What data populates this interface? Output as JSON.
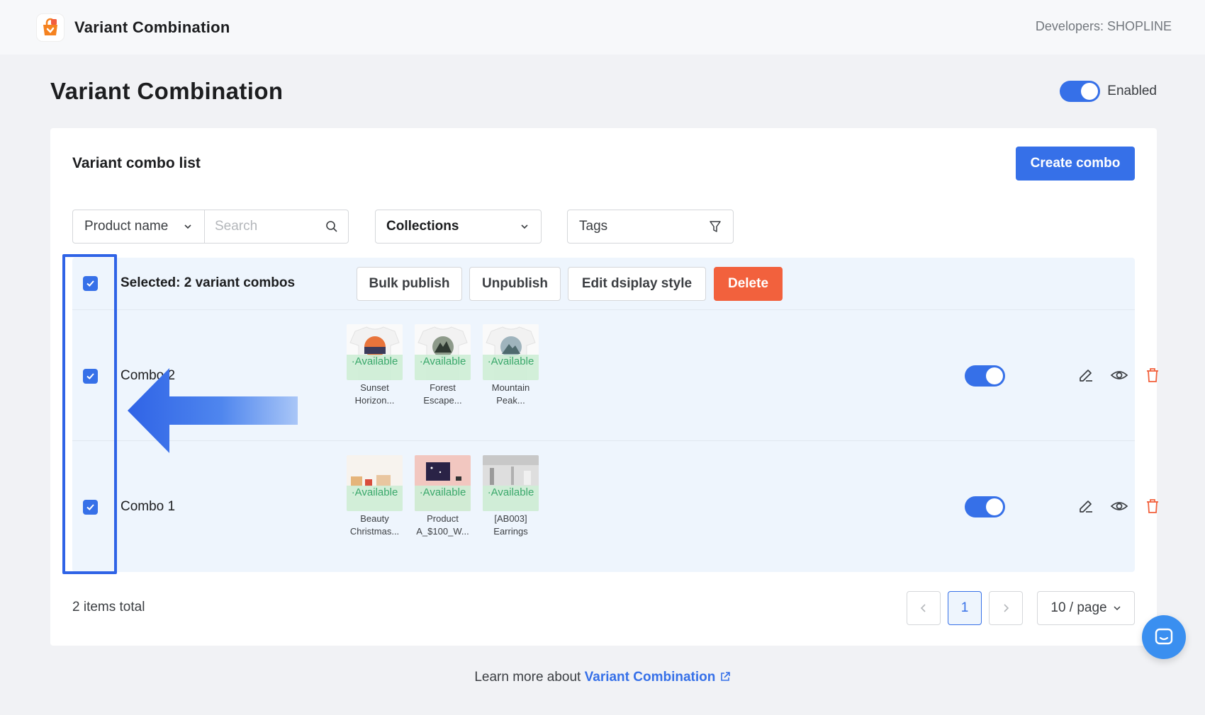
{
  "app": {
    "name": "Variant Combination",
    "developer": "Developers: SHOPLINE"
  },
  "page": {
    "title": "Variant Combination",
    "enabled_label": "Enabled",
    "enabled": true
  },
  "list": {
    "title": "Variant combo list",
    "create_button": "Create combo"
  },
  "filters": {
    "product_select": "Product name",
    "search_placeholder": "Search",
    "collections": "Collections",
    "tags": "Tags"
  },
  "bulk": {
    "selected_text": "Selected: 2 variant combos",
    "publish": "Bulk publish",
    "unpublish": "Unpublish",
    "edit_style": "Edit dsiplay style",
    "delete": "Delete"
  },
  "rows": [
    {
      "name": "Combo 2",
      "checked": true,
      "published": true,
      "products": [
        {
          "status": "·Available",
          "name_line1": "Sunset",
          "name_line2": "Horizon..."
        },
        {
          "status": "·Available",
          "name_line1": "Forest",
          "name_line2": "Escape..."
        },
        {
          "status": "·Available",
          "name_line1": "Mountain",
          "name_line2": "Peak..."
        }
      ]
    },
    {
      "name": "Combo 1",
      "checked": true,
      "published": true,
      "products": [
        {
          "status": "·Available",
          "name_line1": "Beauty",
          "name_line2": "Christmas..."
        },
        {
          "status": "·Available",
          "name_line1": "Product",
          "name_line2": "A_$100_W..."
        },
        {
          "status": "·Available",
          "name_line1": "[AB003]",
          "name_line2": "Earrings"
        }
      ]
    }
  ],
  "pagination": {
    "total": "2 items total",
    "current_page": "1",
    "page_size": "10 / page"
  },
  "footer": {
    "learn_prefix": "Learn more about",
    "learn_link": "Variant Combination"
  },
  "colors": {
    "primary": "#3670e8",
    "danger": "#f2613d",
    "available": "#3aa86b",
    "annotation": "#2f63e6"
  }
}
